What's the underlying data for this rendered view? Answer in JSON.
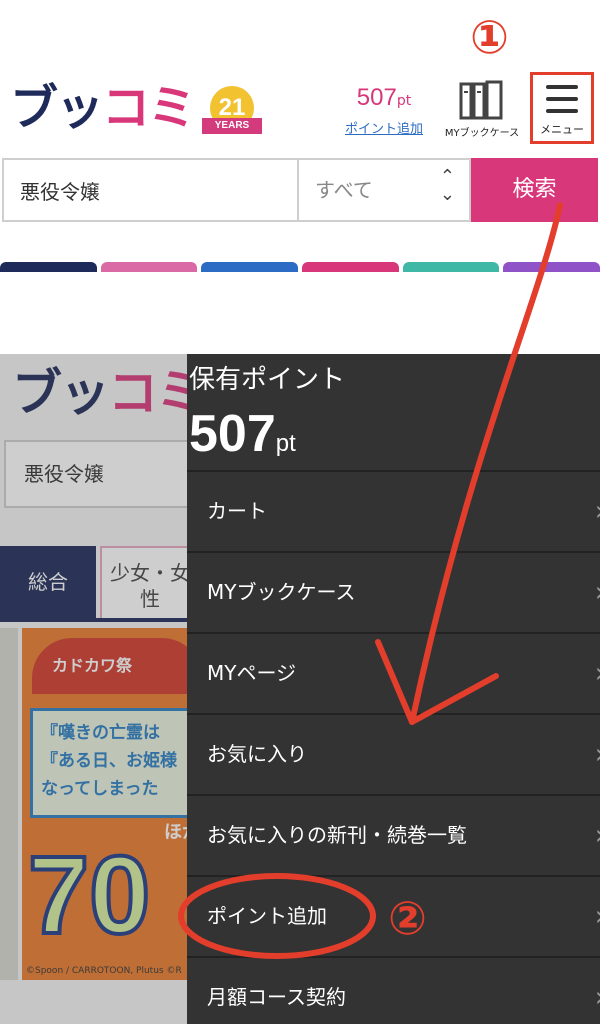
{
  "app": {
    "logo_part1": "ブッ",
    "logo_part2": "コミ",
    "anniversary_number": "21",
    "anniversary_label": "YEARS"
  },
  "header": {
    "points_value": "507",
    "points_unit": "pt",
    "points_add_link": "ポイント追加",
    "bookcase_label": "MYブックケース",
    "menu_label": "メニュー"
  },
  "search": {
    "query_value": "悪役令嬢",
    "category_selected": "すべて",
    "submit_label": "検索"
  },
  "tab_colors": [
    "#1e2a5a",
    "#d96aa5",
    "#2c6cc4",
    "#d8377a",
    "#3fb8a6",
    "#8f52c7"
  ],
  "annotations": {
    "step1": "①",
    "step2": "②",
    "color": "#e33e2c"
  },
  "background_page": {
    "search_value": "悪役令嬢",
    "tab_all": "総合",
    "tab_shoujo": "少女・女性",
    "banner_fan_text": "カドカワ祭",
    "banner_line1": "『嘆きの亡霊は",
    "banner_line2": "『ある日、お姫様",
    "banner_line3": "なってしまった",
    "banner_line4": "ほか",
    "banner_big": "70",
    "banner_credit": "©Spoon / CARROTOON, Plutus ©R"
  },
  "side_menu": {
    "points_heading": "保有ポイント",
    "points_value": "507",
    "points_unit": "pt",
    "items": [
      {
        "label": "カート"
      },
      {
        "label": "MYブックケース"
      },
      {
        "label": "MYページ"
      },
      {
        "label": "お気に入り"
      },
      {
        "label": "お気に入りの新刊・続巻一覧"
      },
      {
        "label": "ポイント追加"
      },
      {
        "label": "月額コース契約"
      }
    ]
  }
}
